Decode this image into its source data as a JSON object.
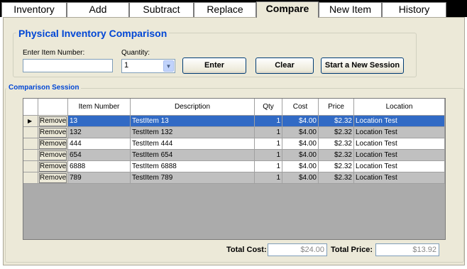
{
  "tabs": [
    {
      "label": "Inventory",
      "active": false
    },
    {
      "label": "Add",
      "active": false
    },
    {
      "label": "Subtract",
      "active": false
    },
    {
      "label": "Replace",
      "active": false
    },
    {
      "label": "Compare",
      "active": true
    },
    {
      "label": "New Item",
      "active": false
    },
    {
      "label": "History",
      "active": false
    }
  ],
  "comparison": {
    "title": "Physical Inventory Comparison",
    "item_number_label": "Enter Item Number:",
    "item_number_value": "",
    "quantity_label": "Quantity:",
    "quantity_value": "1",
    "enter_label": "Enter",
    "clear_label": "Clear",
    "new_session_label": "Start a New Session"
  },
  "session": {
    "title": "Comparison Session",
    "columns": [
      "",
      "Item Number",
      "Description",
      "Qty",
      "Cost",
      "Price",
      "Location"
    ],
    "remove_label": "Remove",
    "rows": [
      {
        "item": "13",
        "desc": "TestItem 13",
        "qty": "1",
        "cost": "$4.00",
        "price": "$2.32",
        "loc": "Location Test",
        "selected": true
      },
      {
        "item": "132",
        "desc": "TestItem 132",
        "qty": "1",
        "cost": "$4.00",
        "price": "$2.32",
        "loc": "Location Test",
        "selected": false
      },
      {
        "item": "444",
        "desc": "TestItem 444",
        "qty": "1",
        "cost": "$4.00",
        "price": "$2.32",
        "loc": "Location Test",
        "selected": false
      },
      {
        "item": "654",
        "desc": "TestItem 654",
        "qty": "1",
        "cost": "$4.00",
        "price": "$2.32",
        "loc": "Location Test",
        "selected": false
      },
      {
        "item": "6888",
        "desc": "TestItem 6888",
        "qty": "1",
        "cost": "$4.00",
        "price": "$2.32",
        "loc": "Location Test",
        "selected": false
      },
      {
        "item": "789",
        "desc": "TestItem 789",
        "qty": "1",
        "cost": "$4.00",
        "price": "$2.32",
        "loc": "Location Test",
        "selected": false
      }
    ],
    "total_cost_label": "Total Cost:",
    "total_cost_value": "$24.00",
    "total_price_label": "Total Price:",
    "total_price_value": "$13.92"
  },
  "colors": {
    "selected_row": "#316ac5",
    "alt_row": "#c0c0c0",
    "title_blue": "#0046d5"
  }
}
